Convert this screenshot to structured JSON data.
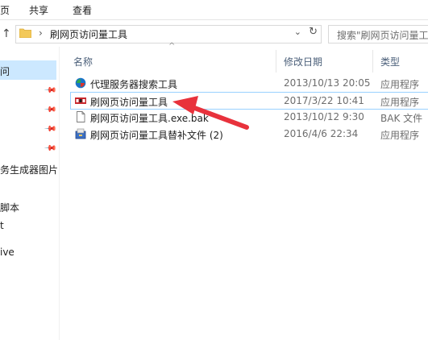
{
  "ribbon": {
    "tabs": [
      "页",
      "共享",
      "查看"
    ]
  },
  "address": {
    "path": "刷网页访问量工具"
  },
  "search": {
    "placeholder": "搜索\"刷网页访问量工具"
  },
  "nav": {
    "items": [
      "问",
      "务生成器图片",
      "脚本",
      "t",
      "ive"
    ]
  },
  "columns": {
    "name": "名称",
    "date": "修改日期",
    "type": "类型"
  },
  "files": [
    {
      "name": "代理服务器搜索工具",
      "date": "2013/10/13 20:05",
      "type": "应用程序",
      "icon": "globe-app-icon"
    },
    {
      "name": "刷网页访问量工具",
      "date": "2017/3/22 10:41",
      "type": "应用程序",
      "icon": "red-app-icon"
    },
    {
      "name": "刷网页访问量工具.exe.bak",
      "date": "2013/10/12 9:30",
      "type": "BAK 文件",
      "icon": "document-icon"
    },
    {
      "name": "刷网页访问量工具替补文件 (2)",
      "date": "2016/4/6 22:34",
      "type": "应用程序",
      "icon": "installer-icon"
    }
  ],
  "colors": {
    "accent": "#e8323c",
    "selection": "#cce8ff",
    "header": "#4c607a",
    "folder": "#f3c95a"
  }
}
